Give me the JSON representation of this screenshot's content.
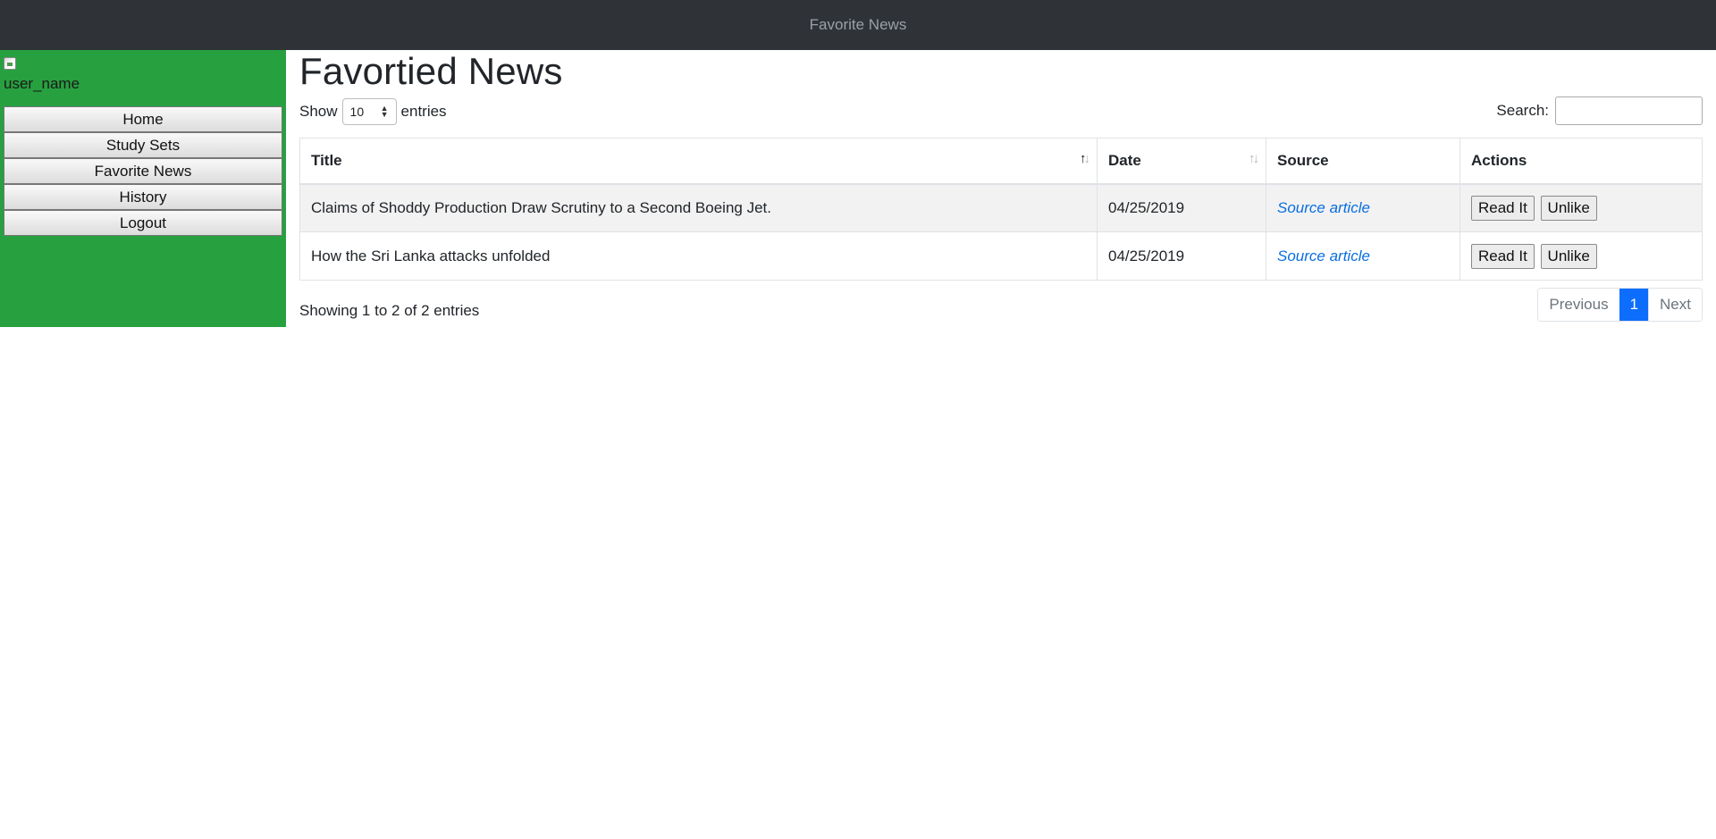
{
  "app": {
    "title": "Favorite News"
  },
  "sidebar": {
    "username": "user_name",
    "items": [
      {
        "label": "Home"
      },
      {
        "label": "Study Sets"
      },
      {
        "label": "Favorite News"
      },
      {
        "label": "History"
      },
      {
        "label": "Logout"
      }
    ]
  },
  "main": {
    "title": "Favortied News",
    "show_label": "Show",
    "entries_label": "entries",
    "page_length": "10",
    "search_label": "Search:",
    "search_value": "",
    "table": {
      "headers": [
        "Title",
        "Date",
        "Source",
        "Actions"
      ],
      "rows": [
        {
          "title": "Claims of Shoddy Production Draw Scrutiny to a Second Boeing Jet.",
          "date": "04/25/2019",
          "source": "Source article",
          "read_label": "Read It",
          "unlike_label": "Unlike"
        },
        {
          "title": "How the Sri Lanka attacks unfolded",
          "date": "04/25/2019",
          "source": "Source article",
          "read_label": "Read It",
          "unlike_label": "Unlike"
        }
      ]
    },
    "info": "Showing 1 to 2 of 2 entries",
    "pagination": {
      "previous": "Previous",
      "current": "1",
      "next": "Next"
    }
  },
  "colors": {
    "topbar": "#2f3338",
    "sidebar": "#27a03f",
    "link": "#0a6ee0",
    "pager_active": "#0d6efd"
  }
}
